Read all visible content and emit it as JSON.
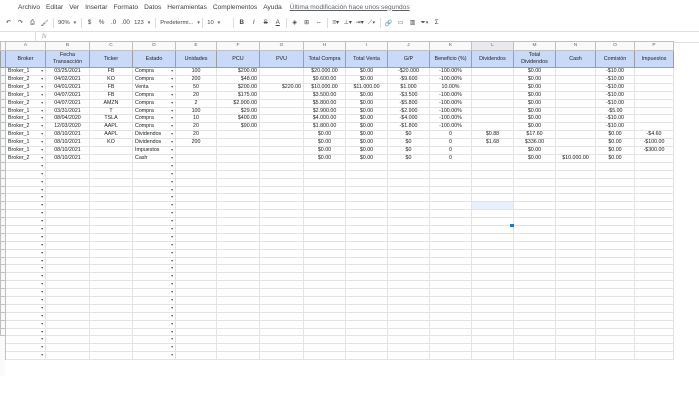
{
  "menu": {
    "items": [
      "Archivo",
      "Editar",
      "Ver",
      "Insertar",
      "Formato",
      "Datos",
      "Herramientas",
      "Complementos",
      "Ayuda"
    ],
    "last_modified": "Última modificación hace unos segundos"
  },
  "toolbar": {
    "zoom": "90%",
    "currency": "$",
    "percent": "%",
    "dec_less": ".0",
    ".dec_more": ".00",
    "more_formats": "123",
    "font": "Predetermi...",
    "font_size": "10",
    "bold": "B",
    "italic": "I",
    "strike": "S",
    "text_color": "A",
    "sigma": "Σ"
  },
  "formula_bar": {
    "cell_ref": "",
    "fx": "fx"
  },
  "columns": [
    "A",
    "B",
    "C",
    "D",
    "E",
    "F",
    "G",
    "H",
    "I",
    "J",
    "K",
    "L",
    "M",
    "N",
    "O",
    "P"
  ],
  "headers": [
    "Broker",
    "Fecha Transacción",
    "Ticker",
    "Estado",
    "Unidades",
    "PCU",
    "PVU",
    "Total Compra",
    "Total Venta",
    "G/P",
    "Beneficio (%)",
    "Dividendos",
    "Total Dividendos",
    "Cash",
    "Comisión",
    "Impuestos"
  ],
  "rows": [
    [
      "Broker_1",
      "03/25/2021",
      "FB",
      "Compra",
      "100",
      "$200.00",
      "",
      "$20.000.00",
      "$0.00",
      "-$20.000",
      "-100.00%",
      "",
      "$0.00",
      "",
      "-$10.00",
      ""
    ],
    [
      "Broker_2",
      "04/02/2021",
      "KO",
      "Compra",
      "200",
      "$48.00",
      "",
      "$9.600.00",
      "$0.00",
      "-$9.600",
      "-100.00%",
      "",
      "$0.00",
      "",
      "-$10.00",
      ""
    ],
    [
      "Broker_3",
      "04/01/2021",
      "FB",
      "Venta",
      "50",
      "$200.00",
      "$220.00",
      "$10.000.00",
      "$11.000.00",
      "$1.000",
      "10.00%",
      "",
      "$0.00",
      "",
      "-$10.00",
      ""
    ],
    [
      "Broker_1",
      "04/07/2021",
      "FB",
      "Compra",
      "20",
      "$175.00",
      "",
      "$3.500.00",
      "$0.00",
      "-$3.500",
      "-100.00%",
      "",
      "$0.00",
      "",
      "-$10.00",
      ""
    ],
    [
      "Broker_2",
      "04/07/2021",
      "AMZN",
      "Compra",
      "2",
      "$2.900.00",
      "",
      "$5.800.00",
      "$0.00",
      "-$5.800",
      "-100.00%",
      "",
      "$0.00",
      "",
      "-$10.00",
      ""
    ],
    [
      "Broker_1",
      "03/31/2021",
      "T",
      "Compra",
      "100",
      "$29.00",
      "",
      "$2.900.00",
      "$0.00",
      "-$2.900",
      "-100.00%",
      "",
      "$0.00",
      "",
      "-$5.00",
      ""
    ],
    [
      "Broker_1",
      "08/04/2020",
      "TSLA",
      "Compra",
      "10",
      "$400.00",
      "",
      "$4.000.00",
      "$0.00",
      "-$4.000",
      "-100.00%",
      "",
      "$0.00",
      "",
      "-$10.00",
      ""
    ],
    [
      "Broker_2",
      "12/03/2020",
      "AAPL",
      "Compra",
      "20",
      "$90.00",
      "",
      "$1.800.00",
      "$0.00",
      "-$1.800",
      "-100.00%",
      "",
      "$0.00",
      "",
      "-$10.00",
      ""
    ],
    [
      "Broker_1",
      "08/10/2021",
      "AAPL",
      "Dividendos",
      "20",
      "",
      "",
      "$0.00",
      "$0.00",
      "$0",
      "0",
      "$0.88",
      "$17.60",
      "",
      "$0.00",
      "-$4.60"
    ],
    [
      "Broker_1",
      "08/10/2021",
      "KO",
      "Dividendos",
      "200",
      "",
      "",
      "$0.00",
      "$0.00",
      "$0",
      "0",
      "$1.68",
      "$336.00",
      "",
      "$0.00",
      "-$100.00"
    ],
    [
      "Broker_1",
      "08/10/2021",
      "",
      "Impuestos",
      "",
      "",
      "",
      "$0.00",
      "$0.00",
      "$0",
      "0",
      "",
      "$0.00",
      "",
      "$0.00",
      "-$300.00"
    ],
    [
      "Broker_2",
      "08/10/2021",
      "",
      "Cash",
      "",
      "",
      "",
      "$0.00",
      "$0.00",
      "$0",
      "0",
      "",
      "$0.00",
      "$10.000.00",
      "$0.00",
      ""
    ]
  ],
  "empty_rows": 25
}
